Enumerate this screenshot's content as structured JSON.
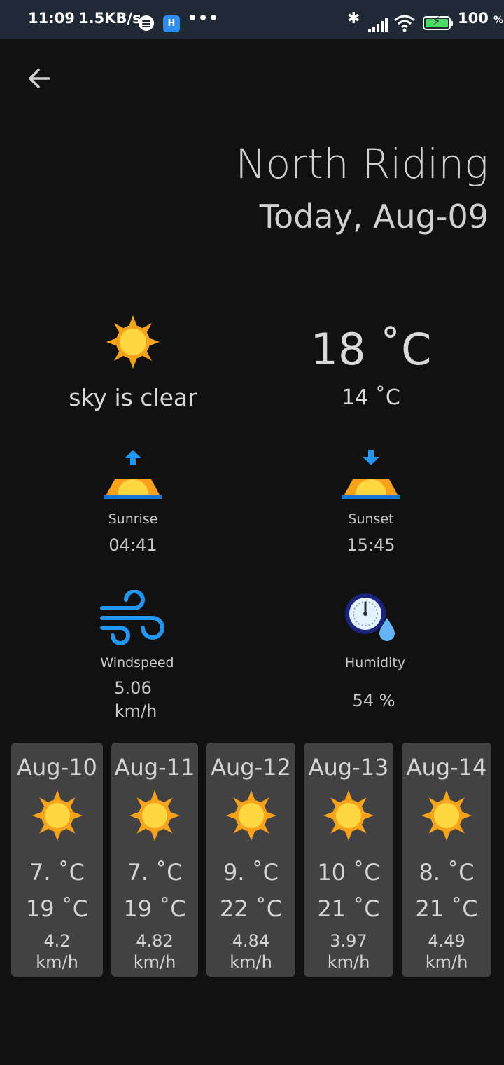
{
  "status_bar": {
    "time": "11:09",
    "net_speed": "1.5KB/s",
    "battery_percent": "100",
    "battery_unit": "%",
    "more": "•••"
  },
  "header": {
    "city": "North Riding",
    "date": "Today, Aug-09"
  },
  "current": {
    "icon": "sun-icon",
    "condition": "sky is clear",
    "temperature": "18 ˚C",
    "feels_like": "14 ˚C"
  },
  "sun": {
    "sunrise_label": "Sunrise",
    "sunrise_time": "04:41",
    "sunset_label": "Sunset",
    "sunset_time": "15:45"
  },
  "details": {
    "windspeed_label": "Windspeed",
    "windspeed_value": "5.06",
    "windspeed_unit": "km/h",
    "humidity_label": "Humidity",
    "humidity_value": "54 %"
  },
  "forecast": [
    {
      "date": "Aug-10",
      "low": "7. ˚C",
      "high": "19 ˚C",
      "wind": "4.2",
      "unit": "km/h"
    },
    {
      "date": "Aug-11",
      "low": "7. ˚C",
      "high": "19 ˚C",
      "wind": "4.82",
      "unit": "km/h"
    },
    {
      "date": "Aug-12",
      "low": "9. ˚C",
      "high": "22 ˚C",
      "wind": "4.84",
      "unit": "km/h"
    },
    {
      "date": "Aug-13",
      "low": "10 ˚C",
      "high": "21 ˚C",
      "wind": "3.97",
      "unit": "km/h"
    },
    {
      "date": "Aug-14",
      "low": "8. ˚C",
      "high": "21 ˚C",
      "wind": "4.49",
      "unit": "km/h"
    }
  ],
  "colors": {
    "background": "#111111",
    "card": "#424242",
    "sun_orange": "#f7a21b",
    "sun_yellow": "#ffd740",
    "accent_blue": "#2196f3"
  }
}
